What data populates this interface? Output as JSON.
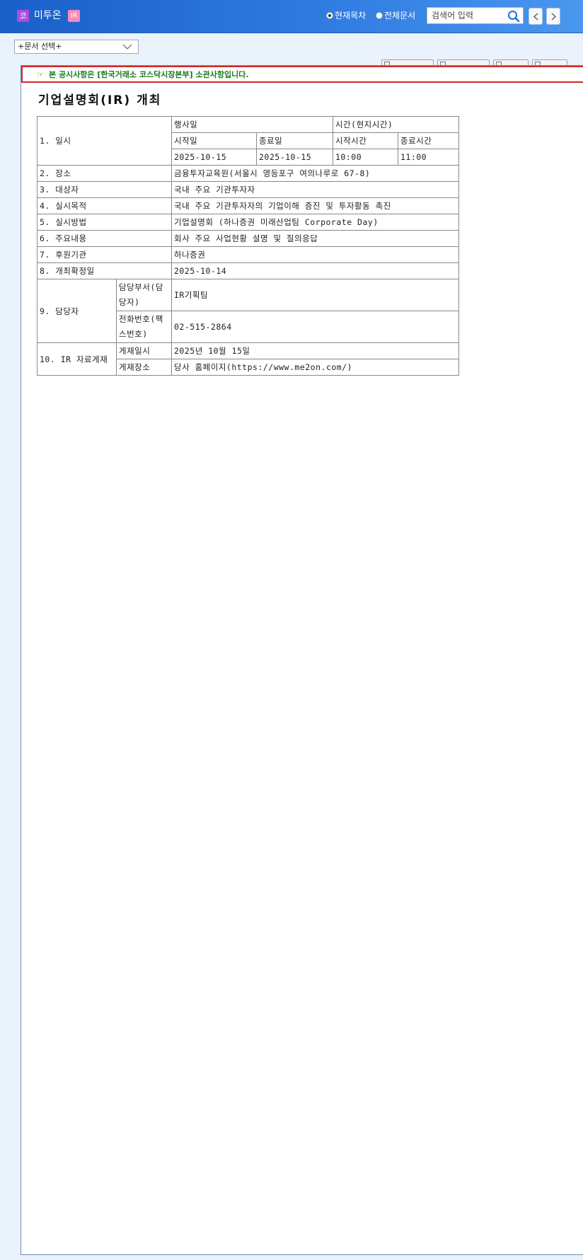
{
  "header": {
    "market_badge": "코",
    "company_name": "미투온",
    "ir_badge": "IR",
    "radio_current": "현재목차",
    "radio_all": "전체문서",
    "search_placeholder": "검색어 입력"
  },
  "doc_select": {
    "selected": "+문서 선택+"
  },
  "notice": {
    "text": "본 공시사항은 [한국거래소 코스닥시장본부] 소관사항입니다."
  },
  "document": {
    "title": "기업설명회(IR) 개최",
    "table": {
      "schedule_label": "1. 일시",
      "event_day_header": "행사일",
      "time_header": "시간(현지시간)",
      "start_date_label": "시작일",
      "end_date_label": "종료일",
      "start_time_label": "시작시간",
      "end_time_label": "종료시간",
      "start_date": "2025-10-15",
      "end_date": "2025-10-15",
      "start_time": "10:00",
      "end_time": "11:00",
      "rows": [
        {
          "label": "2. 장소",
          "value": "금융투자교육원(서울시 영등포구 여의나루로 67-8)"
        },
        {
          "label": "3. 대상자",
          "value": "국내 주요 기관투자자"
        },
        {
          "label": "4. 실시목적",
          "value": "국내 주요 기관투자자의 기업이해 증진 및 투자활동 촉진"
        },
        {
          "label": "5. 실시방법",
          "value": "기업설명회 (하나증권 미래산업팀 Corporate Day)"
        },
        {
          "label": "6. 주요내용",
          "value": "회사 주요 사업현황 설명 및 질의응답"
        },
        {
          "label": "7. 후원기관",
          "value": "하나증권"
        },
        {
          "label": "8. 개최확정일",
          "value": "2025-10-14"
        }
      ],
      "contact_label": "9. 담당자",
      "dept_label": "담당부서(담당자)",
      "dept_value": "IR기획팀",
      "phone_label": "전화번호(팩스번호)",
      "phone_value": "02-515-2864",
      "material_label": "10. IR 자료게재",
      "post_date_label": "게재일시",
      "post_date_value": "2025년 10월 15일",
      "post_place_label": "게재장소",
      "post_place_value": "당사 홈페이지(https://www.me2on.com/)"
    }
  }
}
